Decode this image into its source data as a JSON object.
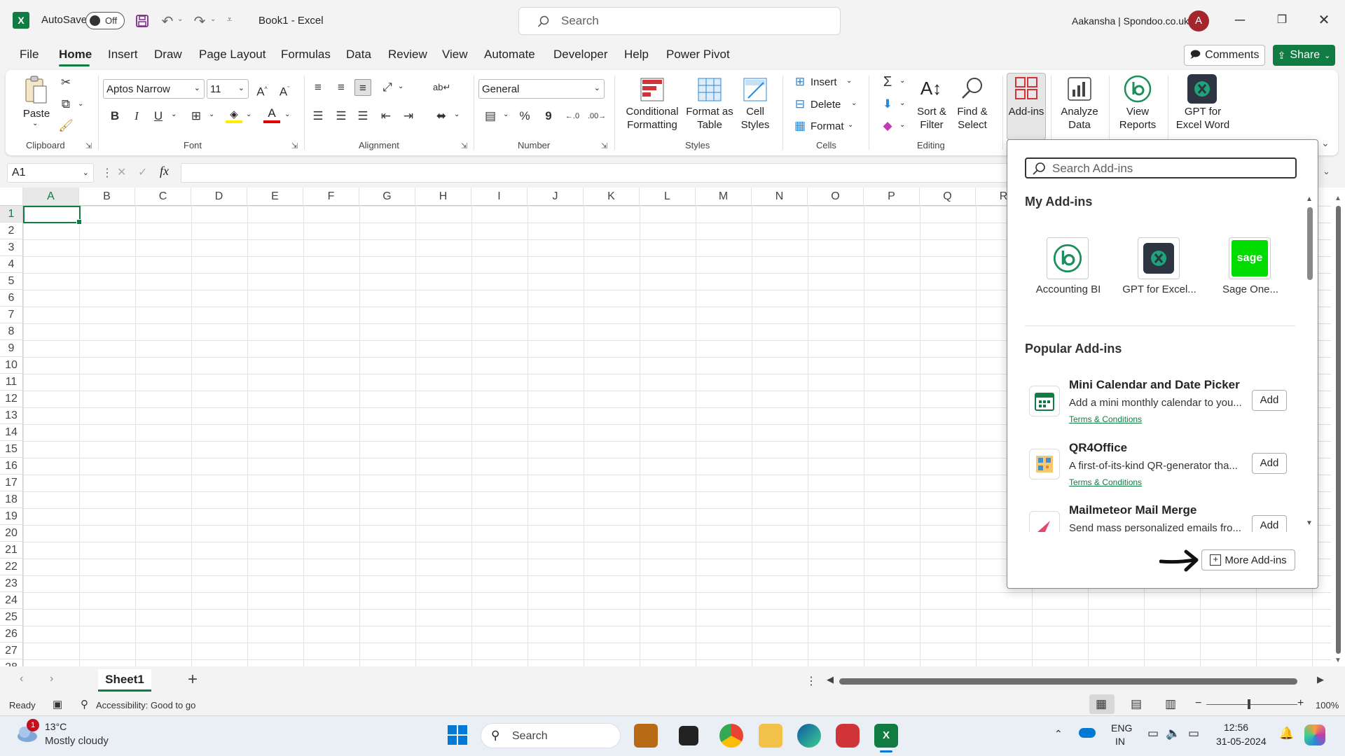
{
  "titlebar": {
    "autosave_label": "AutoSave",
    "autosave_state": "Off",
    "doc_title": "Book1  -  Excel",
    "search_placeholder": "Search",
    "user": "Aakansha | Spondoo.co.uk",
    "avatar_initial": "A"
  },
  "menu_tabs": [
    "File",
    "Home",
    "Insert",
    "Draw",
    "Page Layout",
    "Formulas",
    "Data",
    "Review",
    "View",
    "Automate",
    "Developer",
    "Help",
    "Power Pivot"
  ],
  "header_buttons": {
    "comments": "Comments",
    "share": "Share"
  },
  "ribbon": {
    "clipboard": {
      "paste": "Paste",
      "group": "Clipboard"
    },
    "font": {
      "name": "Aptos Narrow",
      "size": "11",
      "group": "Font",
      "bold": "B",
      "italic": "I",
      "underline": "U"
    },
    "alignment": {
      "group": "Alignment"
    },
    "number": {
      "format": "General",
      "group": "Number",
      "percent": "%",
      "comma": "9"
    },
    "styles": {
      "group": "Styles",
      "conditional_1": "Conditional",
      "conditional_2": "Formatting",
      "table_1": "Format as",
      "table_2": "Table",
      "cell_1": "Cell",
      "cell_2": "Styles"
    },
    "cells": {
      "group": "Cells",
      "insert": "Insert",
      "delete": "Delete",
      "format": "Format"
    },
    "editing": {
      "group": "Editing",
      "sort_1": "Sort &",
      "sort_2": "Filter",
      "find_1": "Find &",
      "find_2": "Select"
    },
    "addins": {
      "label": "Add-ins"
    },
    "analyze": {
      "label_1": "Analyze",
      "label_2": "Data"
    },
    "view_reports": {
      "label_1": "View",
      "label_2": "Reports"
    },
    "gpt": {
      "label_1": "GPT for",
      "label_2": "Excel Word"
    }
  },
  "formula_bar": {
    "namebox": "A1",
    "fx": "fx",
    "value": ""
  },
  "grid": {
    "columns": [
      "A",
      "B",
      "C",
      "D",
      "E",
      "F",
      "G",
      "H",
      "I",
      "J",
      "K",
      "L",
      "M",
      "N",
      "O",
      "P",
      "Q",
      "R"
    ],
    "rows": [
      "1",
      "2",
      "3",
      "4",
      "5",
      "6",
      "7",
      "8",
      "9",
      "10",
      "11",
      "12",
      "13",
      "14",
      "15",
      "16",
      "17",
      "18",
      "19",
      "20",
      "21",
      "22",
      "23",
      "24",
      "25",
      "26",
      "27",
      "28"
    ],
    "selected_cell": "A1"
  },
  "sheets": {
    "active": "Sheet1",
    "add": "+"
  },
  "status": {
    "ready": "Ready",
    "accessibility": "Accessibility: Good to go",
    "zoom": "100%"
  },
  "addins_panel": {
    "search_placeholder": "Search Add-ins",
    "my_heading": "My Add-ins",
    "my_addins": [
      {
        "label": "Accounting BI"
      },
      {
        "label": "GPT for Excel..."
      },
      {
        "label": "Sage One..."
      }
    ],
    "sage_logo_text": "sage",
    "popular_heading": "Popular Add-ins",
    "popular": [
      {
        "title": "Mini Calendar and Date Picker",
        "desc": "Add a mini monthly calendar to you...",
        "terms": "Terms & Conditions",
        "add": "Add"
      },
      {
        "title": "QR4Office",
        "desc": "A first-of-its-kind QR-generator tha...",
        "terms": "Terms & Conditions",
        "add": "Add"
      },
      {
        "title": "Mailmeteor Mail Merge",
        "desc": "Send mass personalized emails fro...",
        "terms": "",
        "add": "Add"
      }
    ],
    "more": "More Add-ins"
  },
  "taskbar": {
    "weather_temp": "13°C",
    "weather_desc": "Mostly cloudy",
    "weather_badge": "1",
    "search": "Search",
    "lang_1": "ENG",
    "lang_2": "IN",
    "time": "12:56",
    "date": "31-05-2024"
  },
  "colors": {
    "excel_green": "#107c41",
    "avatar_red": "#a4262c",
    "sage_green": "#00dc00"
  }
}
